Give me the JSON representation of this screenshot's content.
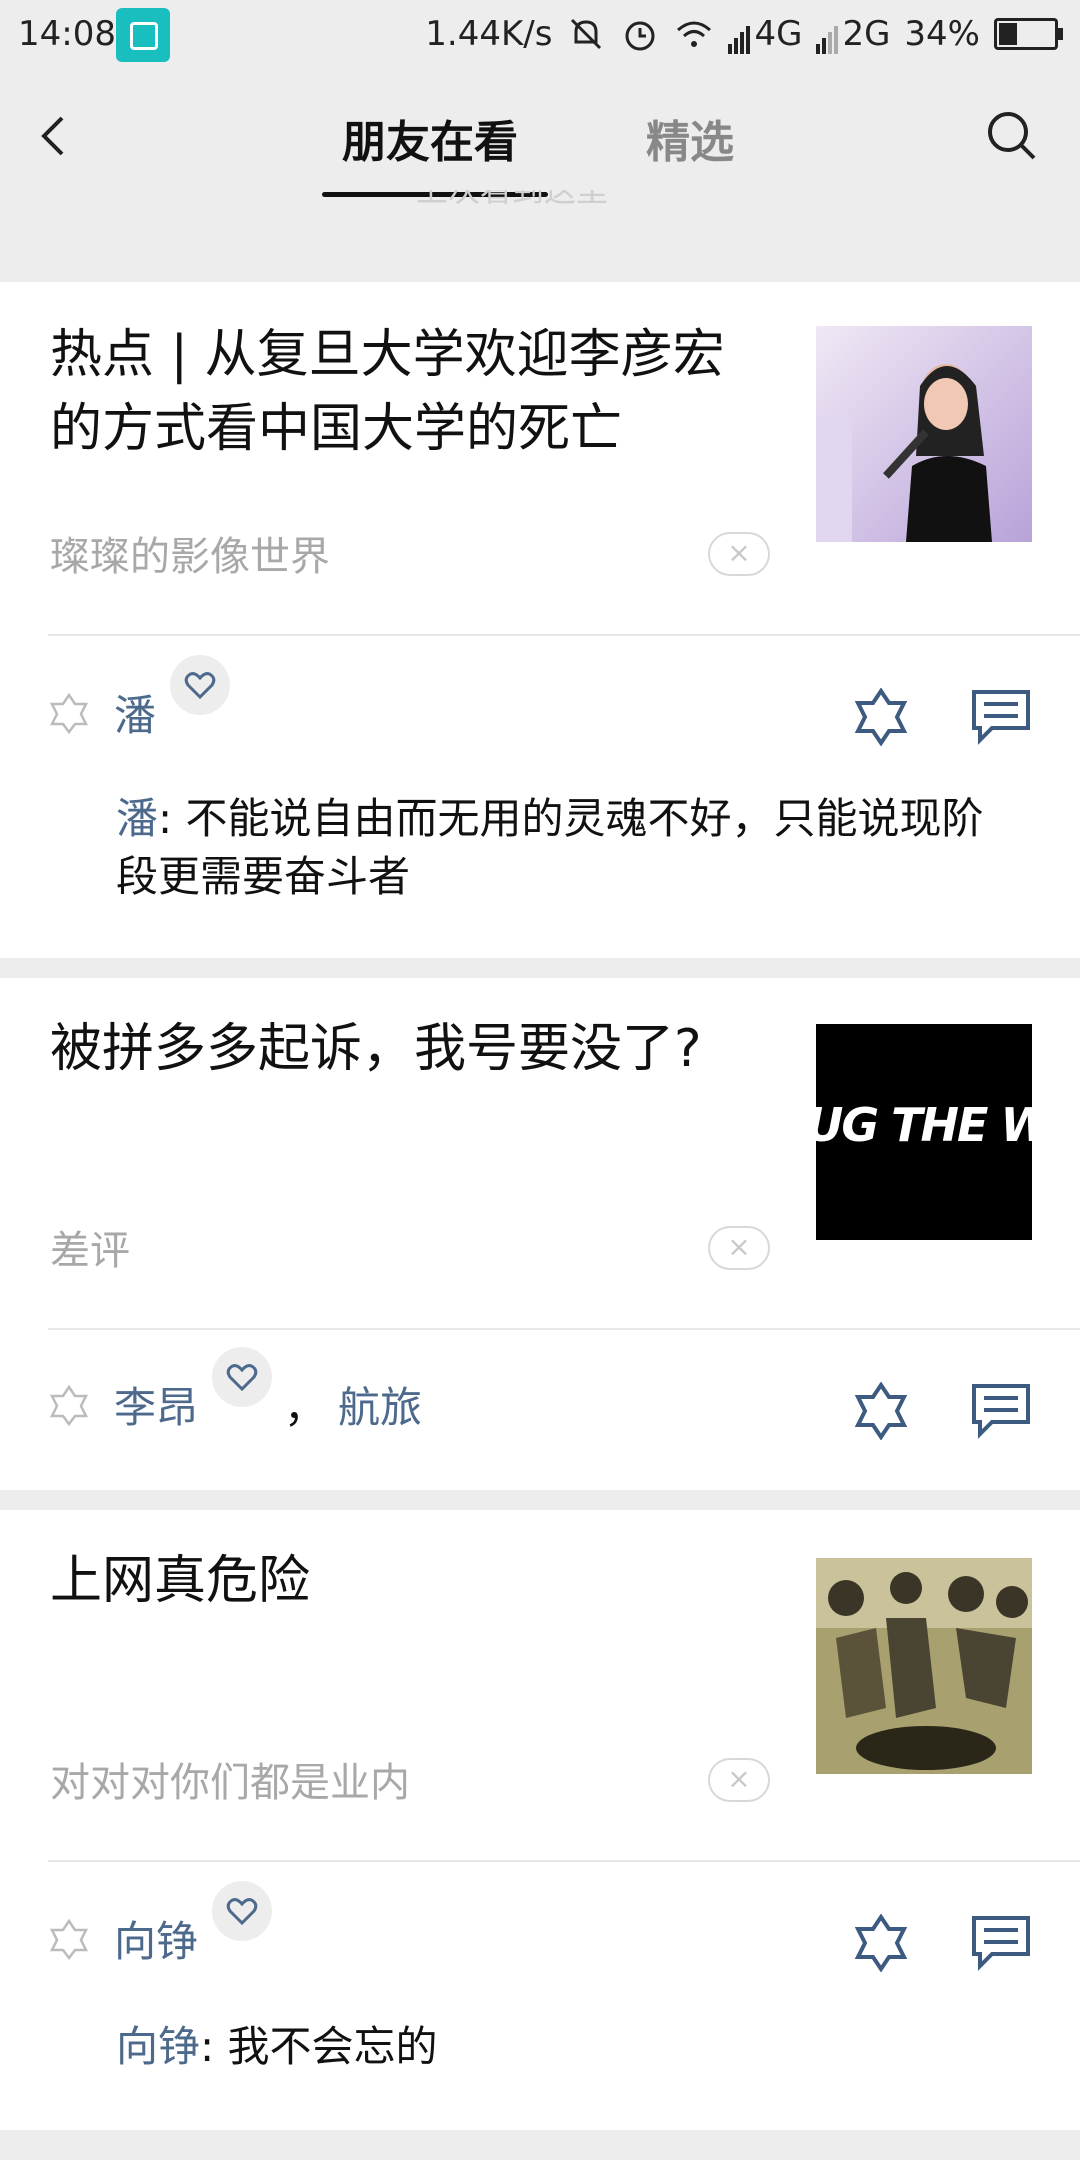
{
  "status_bar": {
    "time": "14:08",
    "net_speed": "1.44K/s",
    "signal1": "4G",
    "signal2": "2G",
    "battery": "34%",
    "battery_level": 0.34
  },
  "nav": {
    "tab_active": "朋友在看",
    "tab_inactive": "精选",
    "peek_text": "上次看到这里"
  },
  "articles": [
    {
      "title": "热点 | 从复旦大学欢迎李彦宏的方式看中国大学的死亡",
      "source": "璨璨的影像世界",
      "friends": [
        "潘"
      ],
      "comment_author": "潘",
      "comment_text": ": 不能说自由而无用的灵魂不好，只能说现阶段更需要奋斗者"
    },
    {
      "title": "被拼多多起诉，我号要没了?",
      "source": "差评",
      "friends": [
        "李昂",
        "航旅 "
      ],
      "separator": "，",
      "thumb_text": "UG THE WO"
    },
    {
      "title": "上网真危险",
      "source": "对对对你们都是业内",
      "friends": [
        "向铮"
      ],
      "comment_author": "向铮",
      "comment_text": ": 我不会忘的"
    }
  ],
  "close_glyph": "×",
  "colors": {
    "link": "#4d6a8c",
    "accent_icon": "#3d5a80",
    "bg": "#ededed"
  }
}
